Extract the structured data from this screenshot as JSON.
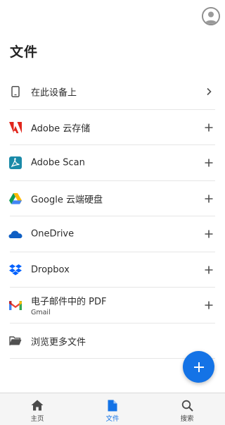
{
  "header": {
    "title": "文件",
    "avatar_icon": "user-avatar-icon"
  },
  "locations": [
    {
      "name": "device",
      "label": "在此设备上",
      "sub": "",
      "icon": "phone-icon",
      "action": "chevron-right-icon"
    },
    {
      "name": "adobe-cloud",
      "label": "Adobe 云存储",
      "sub": "",
      "icon": "adobe-logo-icon",
      "action": "plus-icon"
    },
    {
      "name": "adobe-scan",
      "label": "Adobe Scan",
      "sub": "",
      "icon": "adobe-scan-icon",
      "action": "plus-icon"
    },
    {
      "name": "google-drive",
      "label": "Google 云端硬盘",
      "sub": "",
      "icon": "google-drive-icon",
      "action": "plus-icon"
    },
    {
      "name": "onedrive",
      "label": "OneDrive",
      "sub": "",
      "icon": "onedrive-icon",
      "action": "plus-icon"
    },
    {
      "name": "dropbox",
      "label": "Dropbox",
      "sub": "",
      "icon": "dropbox-icon",
      "action": "plus-icon"
    },
    {
      "name": "gmail",
      "label": "电子邮件中的 PDF",
      "sub": "Gmail",
      "icon": "gmail-icon",
      "action": "plus-icon"
    },
    {
      "name": "browse-more",
      "label": "浏览更多文件",
      "sub": "",
      "icon": "folder-icon",
      "action": ""
    }
  ],
  "fab": {
    "icon": "plus-icon"
  },
  "bottom_nav": {
    "items": [
      {
        "label": "主页",
        "icon": "home-icon",
        "active": false
      },
      {
        "label": "文件",
        "icon": "file-icon",
        "active": true
      },
      {
        "label": "搜索",
        "icon": "search-icon",
        "active": false
      }
    ]
  },
  "colors": {
    "accent": "#1473e6",
    "adobe_red": "#e1251b",
    "scan_teal": "#1a8aa8",
    "onedrive_blue": "#0f5fc4",
    "dropbox_blue": "#0061fe"
  }
}
